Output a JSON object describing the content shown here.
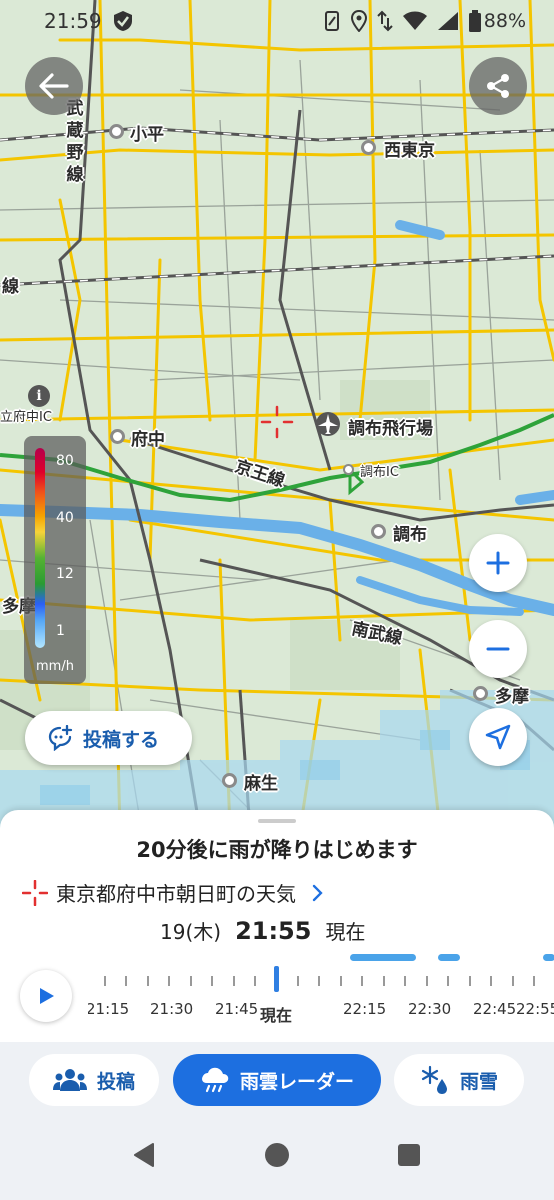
{
  "status_bar": {
    "time": "21:59",
    "battery": "88%"
  },
  "map": {
    "labels": {
      "kodaira": "小平",
      "nishitokyo": "西東京",
      "musashino_line": "武蔵野線",
      "line_left": "線",
      "fuchu": "府中",
      "chofu_airport": "調布飛行場",
      "keio_line": "京王線",
      "chofu_ic": "調布IC",
      "chofu": "調布",
      "tama_left": "多摩",
      "nambu_line": "南武線",
      "tama_right": "多摩",
      "asao": "麻生",
      "kunitachi_fuchu_ic": "立府中IC"
    },
    "colors": {
      "land": "#dbe9d6",
      "road": "#f5c400",
      "river": "#6ab0e8",
      "railway": "#555555",
      "highway": "#2ea33a",
      "rain": "#a8d8f0"
    }
  },
  "legend": {
    "values": [
      "80",
      "40",
      "12",
      "1"
    ],
    "unit": "mm/h"
  },
  "buttons": {
    "back_icon": "arrow-left-icon",
    "share_icon": "share-icon",
    "info_icon": "info-icon",
    "zoom_in_icon": "plus-icon",
    "zoom_out_icon": "minus-icon",
    "locate_icon": "location-arrow-icon"
  },
  "post_button": {
    "label": "投稿する"
  },
  "sheet": {
    "forecast": "20分後に雨が降りはじめます",
    "location": "東京都府中市朝日町の天気",
    "date": "19(木)",
    "time": "21:55",
    "current": "現在",
    "timeline": {
      "labels": [
        "21:15",
        "21:30",
        "21:45",
        "現在",
        "22:15",
        "22:30",
        "22:45",
        "22:55"
      ]
    }
  },
  "tabs": [
    {
      "label": "投稿",
      "icon": "people-icon"
    },
    {
      "label": "雨雲レーダー",
      "icon": "rain-cloud-icon"
    },
    {
      "label": "雨雪",
      "icon": "snow-drop-icon"
    }
  ]
}
